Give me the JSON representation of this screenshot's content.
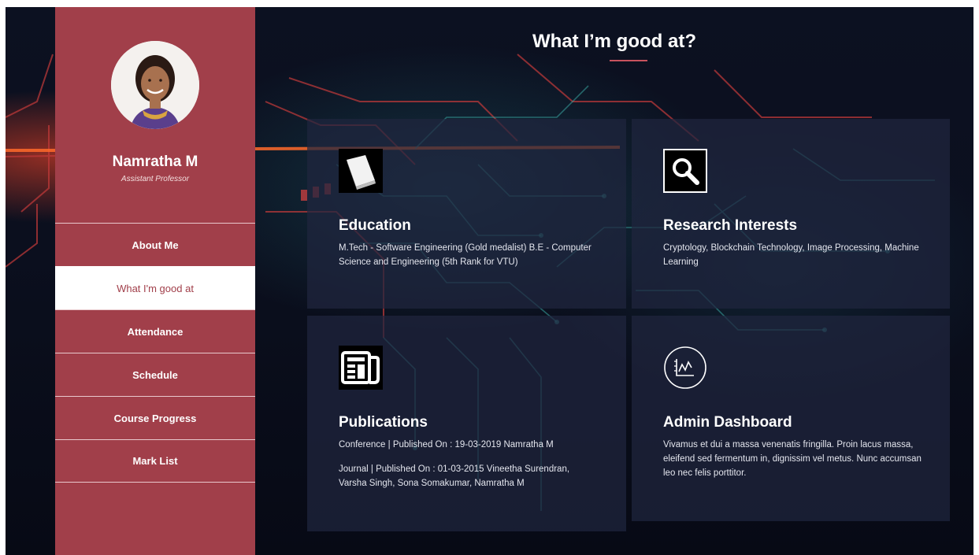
{
  "profile": {
    "name": "Namratha M",
    "role": "Assistant Professor"
  },
  "nav": {
    "items": [
      {
        "label": "About Me",
        "active": false
      },
      {
        "label": "What I'm good at",
        "active": true
      },
      {
        "label": "Attendance",
        "active": false
      },
      {
        "label": "Schedule",
        "active": false
      },
      {
        "label": "Course Progress",
        "active": false
      },
      {
        "label": "Mark List",
        "active": false
      }
    ]
  },
  "main": {
    "title": "What I’m good at?",
    "cards": [
      {
        "icon": "book-icon",
        "title": "Education",
        "lines": [
          "M.Tech - Software Engineering (Gold medalist) B.E - Computer Science and Engineering (5th Rank for VTU)"
        ]
      },
      {
        "icon": "search-icon",
        "title": "Research Interests",
        "lines": [
          "Cryptology, Blockchain Technology, Image Processing, Machine Learning"
        ]
      },
      {
        "icon": "newspaper-icon",
        "title": "Publications",
        "lines": [
          "Conference | Published On : 19-03-2019 Namratha M",
          "Journal | Published On : 01-03-2015 Vineetha Surendran, Varsha Singh, Sona Somakumar, Namratha M"
        ]
      },
      {
        "icon": "chart-icon",
        "title": "Admin Dashboard",
        "lines": [
          "Vivamus et dui a massa venenatis fringilla. Proin lacus massa, eleifend sed fermentum in, dignissim vel metus. Nunc accumsan leo nec felis porttitor."
        ]
      }
    ]
  },
  "colors": {
    "sidebar": "#a13f4a",
    "accent_underline": "#c8525e",
    "card_bg": "#20263e",
    "page_bg": "#0b0f1e"
  }
}
